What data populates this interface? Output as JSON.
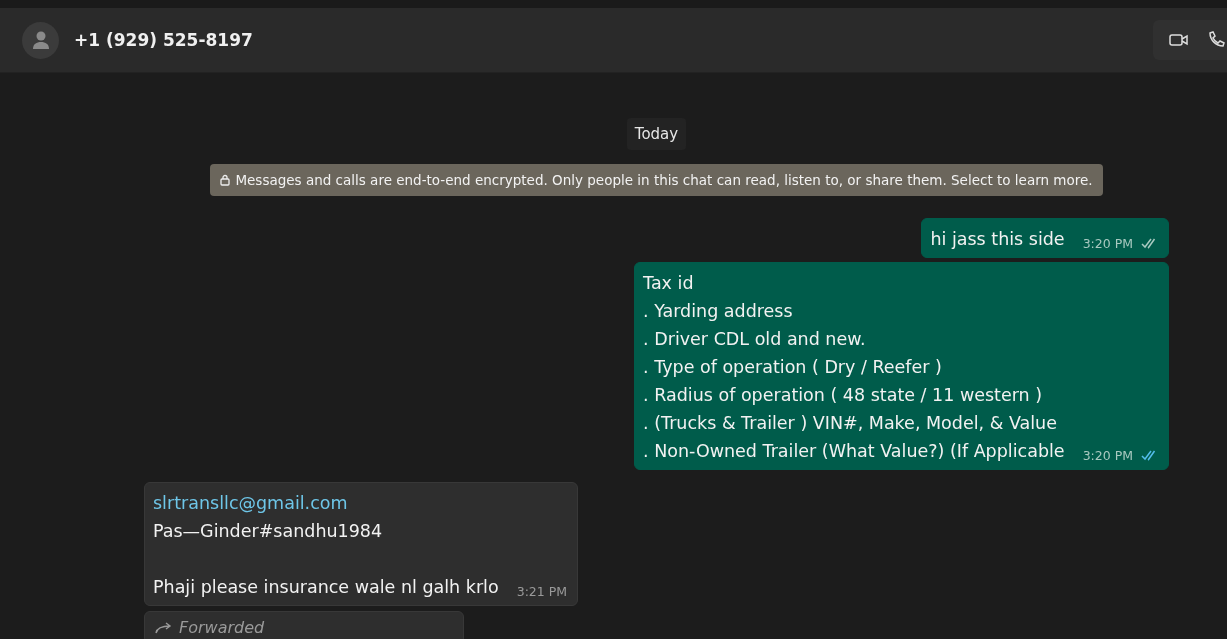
{
  "header": {
    "contact": "+1 (929) 525-8197"
  },
  "date_chip": "Today",
  "encryption_notice": "Messages and calls are end-to-end encrypted. Only people in this chat can read, listen to, or share them. Select to learn more.",
  "messages": [
    {
      "kind": "outgoing",
      "lines": [
        {
          "kind": "text",
          "text": "hi jass this side"
        }
      ],
      "time": "3:20 PM",
      "read": false
    },
    {
      "kind": "outgoing",
      "lines": [
        {
          "kind": "text",
          "text": "Tax id"
        },
        {
          "kind": "text",
          "text": ". Yarding address"
        },
        {
          "kind": "text",
          "text": ". Driver CDL old and new."
        },
        {
          "kind": "text",
          "text": ". Type of operation ( Dry / Reefer )"
        },
        {
          "kind": "text",
          "text": ". Radius of operation ( 48 state / 11 western )"
        },
        {
          "kind": "text",
          "text": ". (Trucks & Trailer ) VIN#, Make, Model, & Value"
        },
        {
          "kind": "text",
          "text": ". Non-Owned Trailer (What Value?) (If Applicable"
        }
      ],
      "time": "3:20 PM",
      "read": true
    },
    {
      "kind": "incoming",
      "lines": [
        {
          "kind": "link",
          "text": "slrtransllc@gmail.com"
        },
        {
          "kind": "text",
          "text": "Pas—Ginder#sandhu1984"
        },
        {
          "kind": "blank"
        },
        {
          "kind": "text",
          "text": "Phaji please insurance wale nl galh krlo"
        }
      ],
      "time": "3:21 PM"
    },
    {
      "kind": "forwarded",
      "label": "Forwarded"
    }
  ]
}
